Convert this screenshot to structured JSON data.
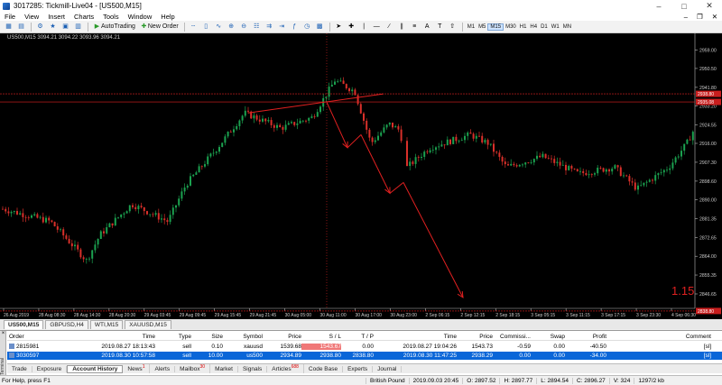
{
  "window": {
    "title": "3017285: Tickmill-Live04 - [US500,M15]"
  },
  "menu": [
    "File",
    "View",
    "Insert",
    "Charts",
    "Tools",
    "Window",
    "Help"
  ],
  "toolbar": {
    "autotrading_label": "AutoTrading",
    "neworder_label": "New Order",
    "timeframes": [
      "M1",
      "M5",
      "M15",
      "M30",
      "H1",
      "H4",
      "D1",
      "W1",
      "MN"
    ],
    "active_timeframe": "M15"
  },
  "chart": {
    "info": "US500,M15  3094.21 3094.22 3093.96 3094.21",
    "spread": "1.15",
    "price_labels": [
      "2959.00",
      "2950.50",
      "2941.80",
      "2933.20",
      "2924.55",
      "2916.00",
      "2907.30",
      "2898.60",
      "2890.00",
      "2881.35",
      "2872.65",
      "2864.00",
      "2855.35",
      "2846.65"
    ],
    "price_min": 2840,
    "price_max": 2965,
    "time_labels": [
      "26 Aug 2019",
      "28 Aug 08:30",
      "28 Aug 14:30",
      "28 Aug 20:30",
      "29 Aug 03:45",
      "29 Aug 09:45",
      "29 Aug 15:45",
      "29 Aug 21:45",
      "30 Aug 05:00",
      "30 Aug 11:00",
      "30 Aug 17:00",
      "30 Aug 23:00",
      "2 Sep 06:15",
      "2 Sep 12:15",
      "2 Sep 18:15",
      "3 Sep 05:15",
      "3 Sep 11:15",
      "3 Sep 17:15",
      "3 Sep 23:30",
      "4 Sep 06:30"
    ],
    "hline_labels": [
      "2938.80",
      "2935.08",
      "2838.80"
    ],
    "colors": {
      "bull": "#1ba14f",
      "bear": "#d9302a",
      "line": "#e02020",
      "tag": "#c81e1e"
    }
  },
  "chart_tabs": [
    "US500,M15",
    "GBPUSD,H4",
    "WTI,M15",
    "XAUUSD,M15"
  ],
  "terminal": {
    "headers": [
      "Order",
      "Time",
      "Type",
      "Size",
      "Symbol",
      "Price",
      "S / L",
      "T / P",
      "Time",
      "Price",
      "Commissi...",
      "Swap",
      "Profit",
      "Comment"
    ],
    "rows": [
      [
        "2815981",
        "2019.08.27 18:13:43",
        "sell",
        "0.10",
        "xauusd",
        "1539.68",
        "1543.67",
        "0.00",
        "2019.08.27 19:04:26",
        "1543.73",
        "-0.59",
        "0.00",
        "-40.50",
        "[sl]"
      ],
      [
        "3030597",
        "2019.08.30 10:57:58",
        "sell",
        "10.00",
        "us500",
        "2934.89",
        "2938.80",
        "2838.80",
        "2019.08.30 11:47:25",
        "2938.29",
        "0.00",
        "0.00",
        "-34.00",
        "[sl]"
      ]
    ],
    "tabs": [
      "Trade",
      "Exposure",
      "Account History",
      "News",
      "Alerts",
      "Mailbox",
      "Market",
      "Signals",
      "Articles",
      "Code Base",
      "Experts",
      "Journal"
    ],
    "badges": {
      "News": "1",
      "Mailbox": "30",
      "Articles": "688"
    },
    "side_label": "Terminal"
  },
  "status": {
    "help": "For Help, press F1",
    "profile": "British Pound",
    "datetime": "2019.09.03 20:45",
    "open": "O: 2897.52",
    "high": "H: 2897.77",
    "low": "L: 2894.54",
    "close": "C: 2896.27",
    "volume": "V: 324",
    "traffic": "1297/2 kb"
  }
}
